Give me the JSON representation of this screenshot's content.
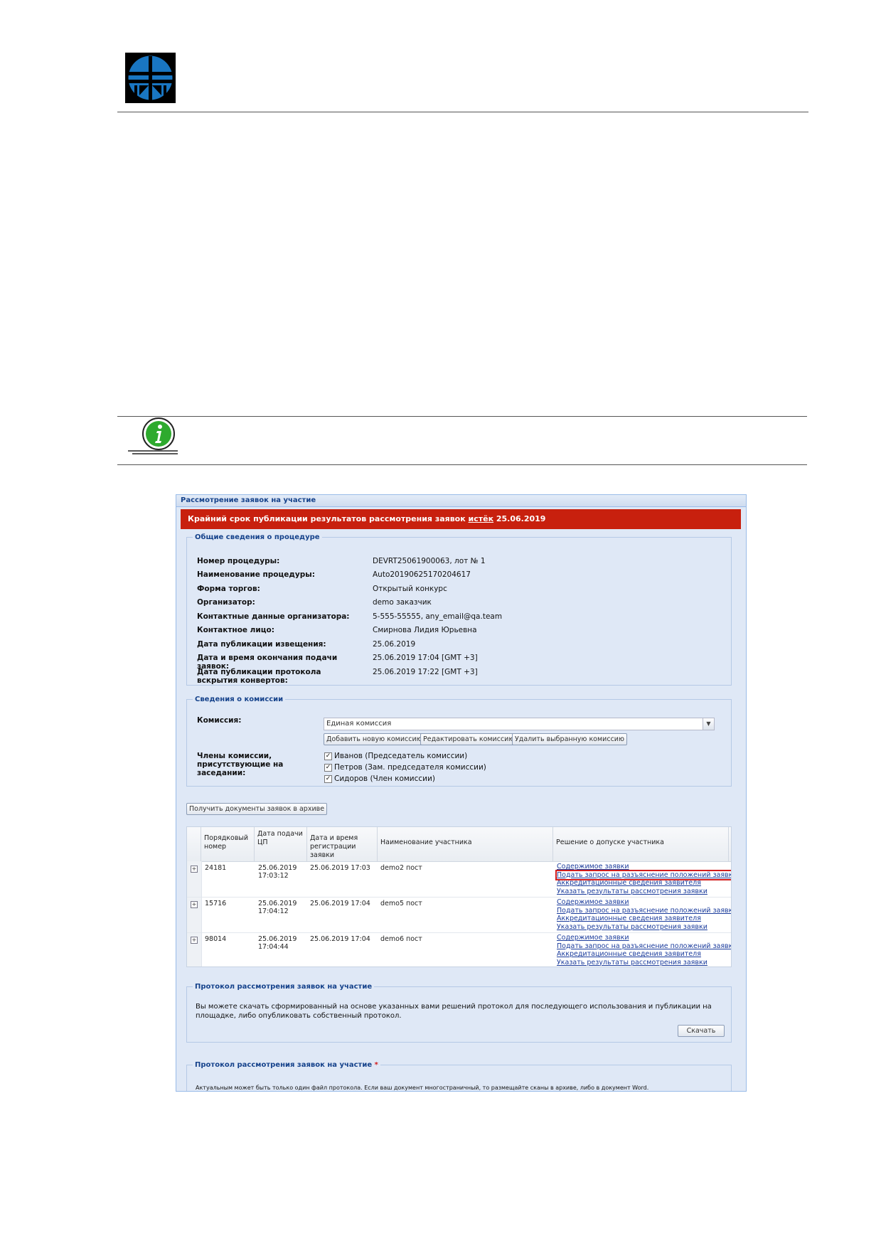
{
  "window": {
    "title": "Рассмотрение заявок на участие"
  },
  "banner": {
    "prefix": "Крайний срок публикации результатов рассмотрения заявок ",
    "highlight": "истёк",
    "suffix": " 25.06.2019"
  },
  "general": {
    "legend": "Общие сведения о процедуре",
    "rows": [
      {
        "label": "Номер процедуры:",
        "value": "DEVRT25061900063, лот № 1"
      },
      {
        "label": "Наименование процедуры:",
        "value": "Auto20190625170204617"
      },
      {
        "label": "Форма торгов:",
        "value": "Открытый конкурс"
      },
      {
        "label": "Организатор:",
        "value": "demo заказчик"
      },
      {
        "label": "Контактные данные организатора:",
        "value": "5-555-55555, any_email@qa.team"
      },
      {
        "label": "Контактное лицо:",
        "value": "Смирнова Лидия Юрьевна"
      },
      {
        "label": "Дата публикации извещения:",
        "value": "25.06.2019"
      },
      {
        "label": "Дата и время окончания подачи заявок:",
        "value": "25.06.2019 17:04 [GMT +3]"
      },
      {
        "label": "Дата публикации протокола вскрытия конвертов:",
        "value": "25.06.2019 17:22 [GMT +3]"
      }
    ]
  },
  "commission": {
    "legend": "Сведения о комиссии",
    "label": "Комиссия:",
    "selected": "Единая комиссия",
    "buttons": [
      "Добавить новую комиссию",
      "Редактировать комиссию",
      "Удалить выбранную комиссию"
    ],
    "members_label": "Члены комиссии, присутствующие на заседании:",
    "members": [
      "Иванов (Председатель комиссии)",
      "Петров (Зам. председателя комиссии)",
      "Сидоров (Член комиссии)"
    ]
  },
  "archive_button": "Получить документы заявок в архиве",
  "table": {
    "headers": [
      "Порядковый номер",
      "Дата подачи ЦП",
      "Дата и время регистрации заявки",
      "Наименование участника",
      "Решение о допуске участника"
    ],
    "rows": [
      {
        "num": "24181",
        "date": "25.06.2019 17:03:12",
        "reg": "25.06.2019 17:03",
        "name": "demo2 пост",
        "links": [
          "Содержимое заявки",
          "Подать запрос на разъяснение положений заявки",
          "Аккредитационные сведения заявителя",
          "Указать результаты рассмотрения заявки"
        ]
      },
      {
        "num": "15716",
        "date": "25.06.2019 17:04:12",
        "reg": "25.06.2019 17:04",
        "name": "demo5 пост",
        "links": [
          "Содержимое заявки",
          "Подать запрос на разъяснение положений заявки",
          "Аккредитационные сведения заявителя",
          "Указать результаты рассмотрения заявки"
        ]
      },
      {
        "num": "98014",
        "date": "25.06.2019 17:04:44",
        "reg": "25.06.2019 17:04",
        "name": "demo6 пост",
        "links": [
          "Содержимое заявки",
          "Подать запрос на разъяснение положений заявки",
          "Аккредитационные сведения заявителя",
          "Указать результаты рассмотрения заявки"
        ]
      }
    ]
  },
  "protocol": {
    "legend": "Протокол рассмотрения заявок на участие",
    "text": "Вы можете скачать сформированный на основе указанных вами решений протокол для последующего использования и публикации на площадке, либо опубликовать собственный протокол.",
    "button": "Скачать"
  },
  "protocol2": {
    "legend": "Протокол рассмотрения заявок на участие",
    "required": "*",
    "text": "Актуальным может быть только один файл протокола. Если ваш документ многостраничный, то размещайте сканы в архиве, либо в документ Word."
  },
  "colors": {
    "banner": "#c8200e",
    "link": "#1b3c9c",
    "highlight": "#d21c1c",
    "panel": "#dfe8f6"
  }
}
